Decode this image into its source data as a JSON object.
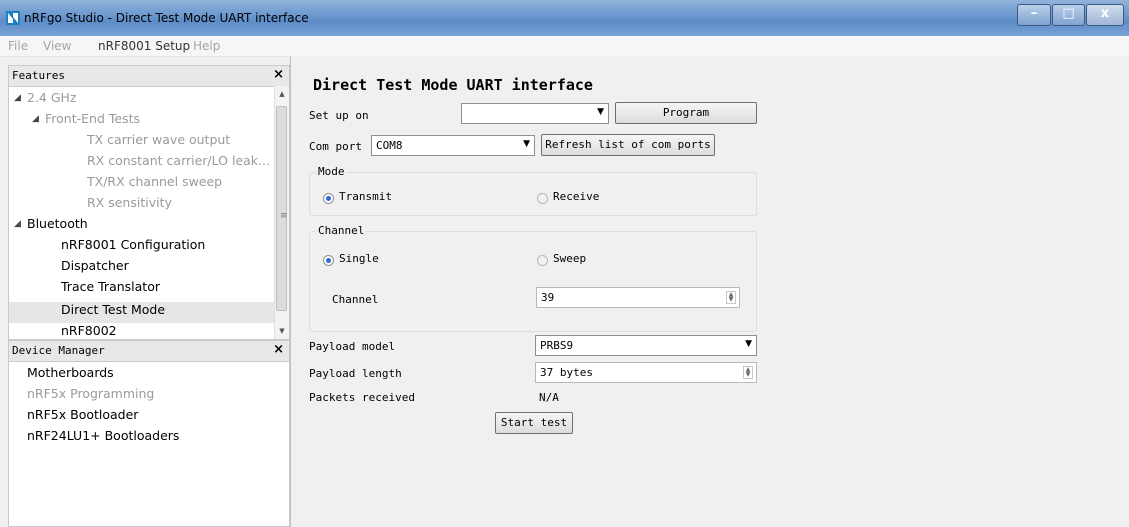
{
  "window": {
    "title": "nRFgo Studio - Direct Test Mode UART interface"
  },
  "menu": [
    "File",
    "View",
    "nRF8001 Setup",
    "Help"
  ],
  "features": {
    "title": "Features",
    "close": "×",
    "items": [
      {
        "label": "2.4 GHz"
      },
      {
        "label": "Front-End Tests"
      },
      {
        "label": "TX carrier wave output"
      },
      {
        "label": "RX constant carrier/LO leak..."
      },
      {
        "label": "TX/RX channel sweep"
      },
      {
        "label": "RX sensitivity"
      },
      {
        "label": "Bluetooth"
      },
      {
        "label": "nRF8001 Configuration"
      },
      {
        "label": "Dispatcher"
      },
      {
        "label": "Trace Translator"
      },
      {
        "label": "Direct Test Mode"
      },
      {
        "label": "nRF8002"
      }
    ]
  },
  "device_manager": {
    "title": "Device Manager",
    "close": "×",
    "items": [
      {
        "label": "Motherboards"
      },
      {
        "label": "nRF5x Programming"
      },
      {
        "label": "nRF5x Bootloader"
      },
      {
        "label": "nRF24LU1+ Bootloaders"
      }
    ]
  },
  "main": {
    "title": "Direct Test Mode UART interface",
    "setup_label": "Set up on",
    "setup_value": "",
    "program_button": "Program",
    "com_port_label": "Com port",
    "com_port_value": "COM8",
    "refresh_button": "Refresh list of com ports",
    "mode": {
      "title": "Mode",
      "transmit": "Transmit",
      "receive": "Receive",
      "selected": "Transmit"
    },
    "channel_group": {
      "title": "Channel",
      "single": "Single",
      "sweep": "Sweep",
      "selected": "Single",
      "channel_label": "Channel",
      "channel_value": "39"
    },
    "payload_model_label": "Payload model",
    "payload_model_value": "PRBS9",
    "payload_length_label": "Payload length",
    "payload_length_value": "37 bytes",
    "packets_received_label": "Packets received",
    "packets_received_value": "N/A",
    "start_button": "Start test"
  },
  "icons": {
    "dropdown": "▼",
    "expanded": "◢",
    "spin_up": "▲",
    "spin_down": "▼",
    "close": "×",
    "grip": "≡"
  },
  "colors": {
    "titlebar": "#6e9ad0",
    "radio_selected": "#2a6ad8",
    "disabled_text": "#9a9a9a"
  }
}
